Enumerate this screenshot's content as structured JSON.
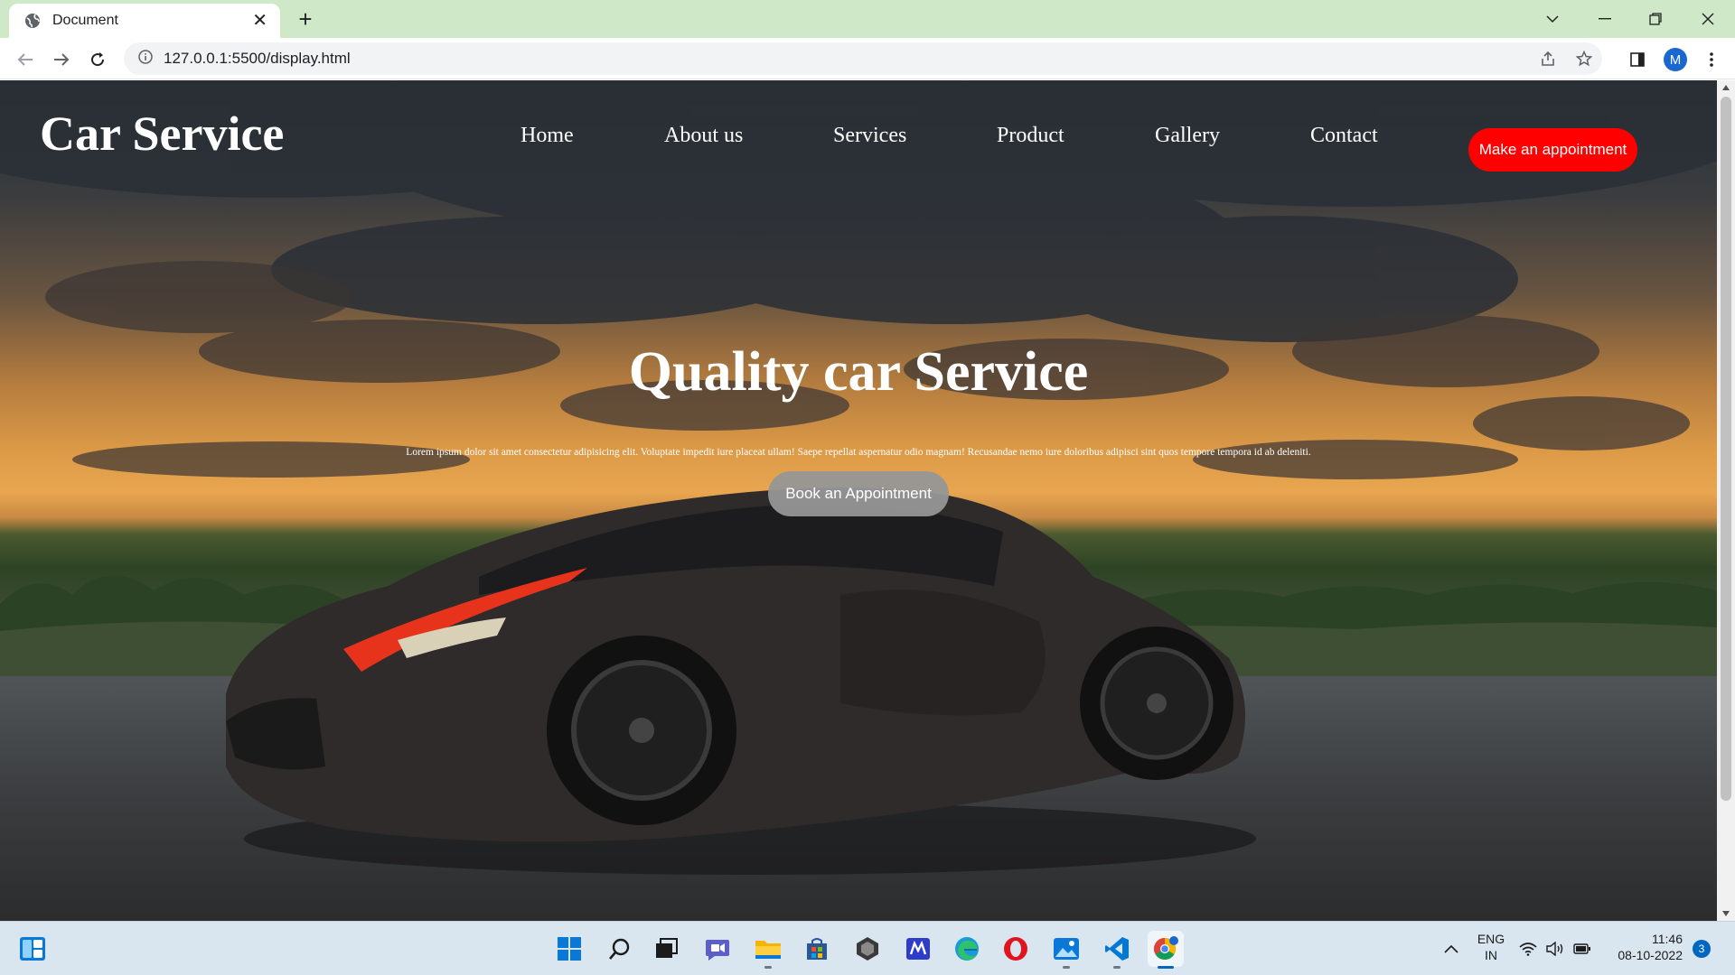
{
  "browser": {
    "tab_title": "Document",
    "url": "127.0.0.1:5500/display.html",
    "profile_initial": "M"
  },
  "page": {
    "logo": "Car Service",
    "nav": [
      "Home",
      "About us",
      "Services",
      "Product",
      "Gallery",
      "Contact"
    ],
    "cta_label": "Make an appointment",
    "hero_title": "Quality car Service",
    "hero_text": "Lorem ipsum dolor sit amet consectetur adipisicing elit. Voluptate impedit iure placeat ullam! Saepe repellat aspernatur odio magnam! Recusandae nemo iure doloribus adipisci sint quos tempore tempora id ab deleniti.",
    "hero_button": "Book an Appointment",
    "colors": {
      "cta": "#ff0000",
      "hero_button": "#969696"
    }
  },
  "taskbar": {
    "language": "ENG",
    "region": "IN",
    "time": "11:46",
    "date": "08-10-2022",
    "notifications": "3",
    "apps": [
      "start-icon",
      "search-icon",
      "task-view-icon",
      "chat-icon",
      "file-explorer-icon",
      "store-icon",
      "app-icon",
      "app-icon",
      "edge-icon",
      "opera-icon",
      "photos-icon",
      "vscode-icon",
      "chrome-icon"
    ]
  }
}
